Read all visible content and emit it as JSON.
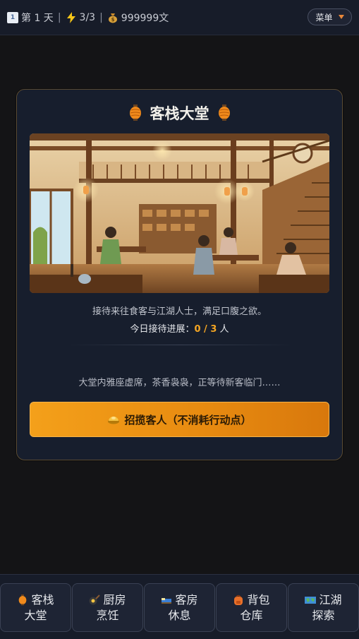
{
  "status": {
    "calendar_icon": "calendar-icon",
    "day_text": "第 1 天",
    "separator1": "|",
    "energy_icon": "lightning-icon",
    "energy_text": "3/3",
    "separator2": "|",
    "money_icon": "money-bag-icon",
    "money_text": "999999文"
  },
  "menu": {
    "label": "菜单",
    "caret_icon": "caret-down-icon"
  },
  "hall": {
    "title": "客栈大堂",
    "lantern_icon": "lantern-icon",
    "description": "接待来往食客与江湖人士，满足口腹之欲。",
    "progress_label": "今日接待进展：",
    "progress_current": "0",
    "progress_sep": " / ",
    "progress_total": "3",
    "progress_unit": " 人",
    "ambient_text": "大堂内雅座虚席，茶香袅袅，正等待新客临门……",
    "recruit_button": "招揽客人（不消耗行动点）",
    "recruit_icon": "gold-ingot-icon"
  },
  "nav": {
    "items": [
      {
        "icon": "lantern-icon",
        "line1": "客栈",
        "line2": "大堂"
      },
      {
        "icon": "frying-pan-icon",
        "line1": "厨房",
        "line2": "烹饪"
      },
      {
        "icon": "bed-icon",
        "line1": "客房",
        "line2": "休息"
      },
      {
        "icon": "backpack-icon",
        "line1": "背包",
        "line2": "仓库"
      },
      {
        "icon": "world-map-icon",
        "line1": "江湖",
        "line2": "探索"
      }
    ]
  },
  "colors": {
    "accent": "#f5a623",
    "button_gradient_start": "#f4a01a",
    "button_gradient_end": "#d8780c",
    "card_border": "#5a4b34",
    "background": "#141416"
  }
}
